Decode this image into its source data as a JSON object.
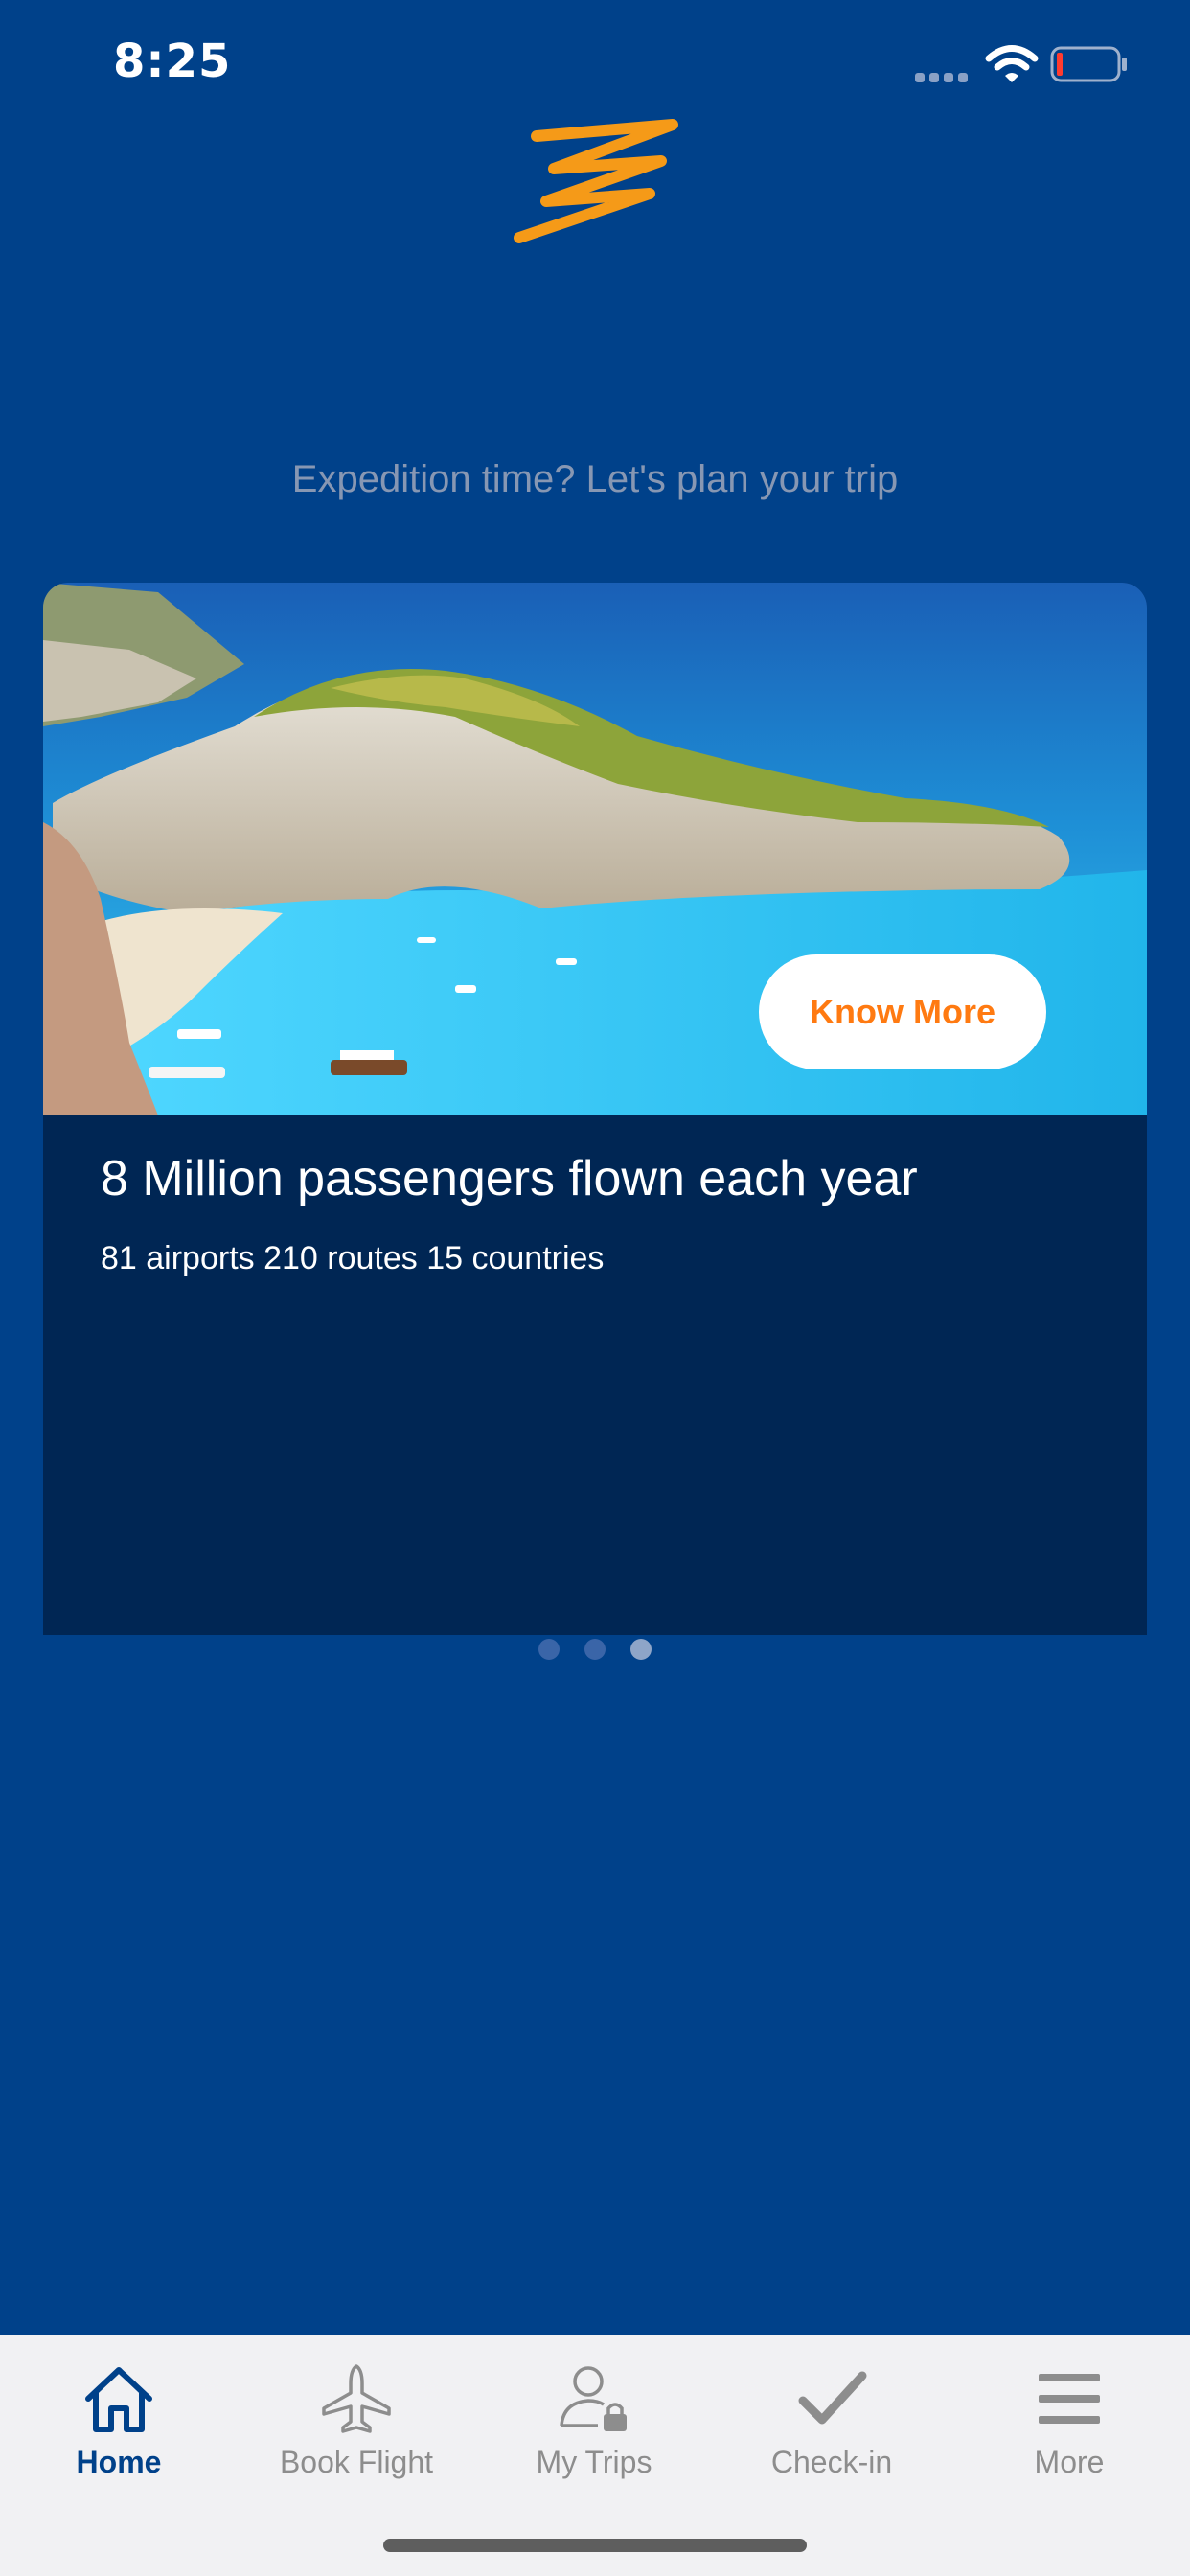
{
  "status_bar": {
    "time": "8:25"
  },
  "colors": {
    "background": "#00418a",
    "accent": "#ff7a11",
    "card": "#002654",
    "tab_bar": "#f1f1f3"
  },
  "header": {
    "logo_icon": "brand-swoosh-logo"
  },
  "tagline": "Expedition time? Let's plan your trip",
  "card": {
    "title": "8 Million passengers flown each year",
    "subtitle": "81 airports 210 routes 15 countries",
    "button_label": "Know More",
    "image": "coastal-cliff-beach-photo"
  },
  "pagination": {
    "count": 3,
    "active_index": 2
  },
  "tab_bar": {
    "tabs": [
      {
        "label": "Home",
        "icon": "home-icon",
        "active": true
      },
      {
        "label": "Book Flight",
        "icon": "plane-icon",
        "active": false
      },
      {
        "label": "My Trips",
        "icon": "person-lock-icon",
        "active": false
      },
      {
        "label": "Check-in",
        "icon": "checkmark-icon",
        "active": false
      },
      {
        "label": "More",
        "icon": "menu-icon",
        "active": false
      }
    ]
  }
}
